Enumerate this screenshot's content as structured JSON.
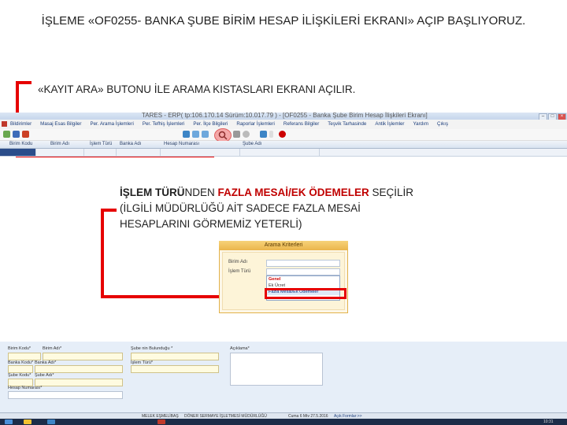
{
  "heading": "İŞLEME «OF0255- BANKA ŞUBE BİRİM HESAP İLİŞKİLERİ EKRANI» AÇIP BAŞLIYORUZ.",
  "instruction1": "«KAYIT ARA» BUTONU İLE ARAMA KISTASLARI EKRANI AÇILIR.",
  "instruction2": {
    "p1": "İŞLEM TÜRÜ",
    "p2": "NDEN ",
    "p3": "FAZLA MESAİ/EK ÖDEMELER",
    "p4": " SEÇİLİR",
    "line2": "(İLGİLİ MÜDÜRLÜĞÜ AİT SADECE FAZLA MESAİ",
    "line3": "HESAPLARINI GÖRMEMİZ YETERLİ)"
  },
  "window": {
    "title": "TARES - ERP( tp:106.170.14 Sürüm:10.017.79 ) - [OF0255 - Banka Şube Birim Hesap İlişkileri Ekranı]",
    "menus": [
      "Bildirimler",
      "Masaj Esas Bilgiler",
      "Per. Arama İşlemleri",
      "Per. Tefhiş İşlemleri",
      "Per. İlçe Bilgileri",
      "Raporlar İşlemleri",
      "Referans Bilgiler",
      "Teşvik Tarhasinde",
      "Antik İşlemler",
      "Yardım",
      "Çıkış"
    ],
    "grid_columns": [
      "Birim Kodu",
      "Birim Adı",
      "İşlem Türü",
      "Banka Adı",
      "Hesap Numarası",
      "Şube Adı"
    ]
  },
  "dialog": {
    "title": "Arama Kriterleri",
    "field1_label": "Birim Adı",
    "field2_label": "İşlem Türü",
    "options": [
      "Genel",
      "Ek Ücret",
      "",
      "Fazla Mesai/Ek Ödemeler"
    ]
  },
  "form": {
    "labels": [
      "Birim Kodu*",
      "Birim Adı*",
      "Banka Kodu*",
      "Banka Adı*",
      "Şube Kodu*",
      "Şube Adı*",
      "Hesap Numarası*",
      "Şube nin Bulunduğu *",
      "İşlem Türü*",
      "Açıklama*"
    ]
  },
  "statusbar": {
    "user": "MELEK EŞMELİBAŞ",
    "dept": "DÖNER SERMAYE İŞLETMESİ MÜDÜRLÜĞÜ",
    "date": "Cuma 6 Mtv 27.5.2016",
    "status": "Açık Formlar:>>"
  },
  "taskbar": {
    "time": "10:31"
  },
  "colors": {
    "highlight_red": "#e60000",
    "dialog_header": "#eab54c",
    "form_bg": "#e6eef8"
  }
}
